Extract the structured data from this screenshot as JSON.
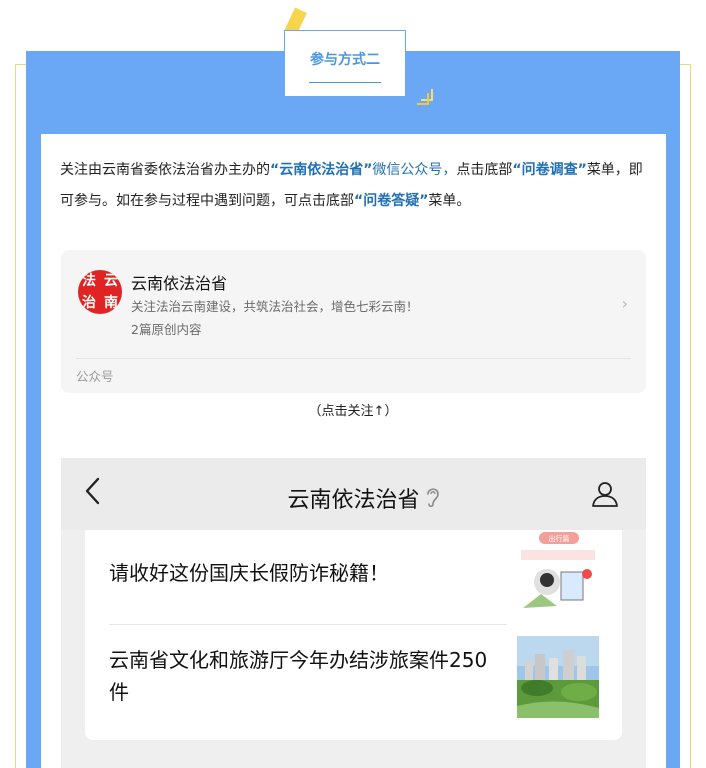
{
  "section_tab": {
    "label": "参与方式二"
  },
  "intro": {
    "p1": "关注由云南省委依法治省办主办的",
    "account_name_quoted": "“云南依法治省”",
    "p2": "微信公众号，",
    "p3": "点击底部",
    "menu_survey": "“问卷调查”",
    "p4": "菜单，即可参与。如在参与过程中遇到问题，可点击底部",
    "menu_faq": "“问卷答疑”",
    "p5": "菜单。"
  },
  "account_card": {
    "logo_chars": [
      "法",
      "云",
      "治",
      "南"
    ],
    "name": "云南依法治省",
    "description": "关注法治云南建设，共筑法治社会，增色七彩云南！",
    "original_count": "2篇原创内容",
    "footer": "公众号"
  },
  "caption": "（点击关注↑）",
  "phone": {
    "title": "云南依法治省",
    "articles": [
      {
        "title": "请收好这份国庆长假防诈秘籍！",
        "thumb_label": "出行篇"
      },
      {
        "title": "云南省文化和旅游厅今年办结涉旅案件250件"
      }
    ]
  },
  "colors": {
    "accent_blue": "#6aa8f5",
    "link_blue": "#1f6fb5",
    "logo_red": "#e02424",
    "yellow": "#f6d54c"
  }
}
